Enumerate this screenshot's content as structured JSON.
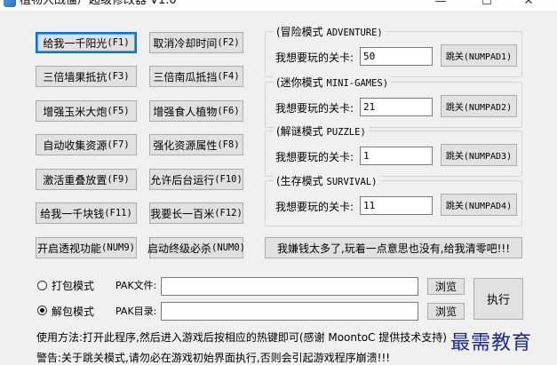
{
  "window": {
    "title": "植物大战僵尸超级修改器 V1.0",
    "minimize": "—",
    "maximize": "☐",
    "close": "✕"
  },
  "cheats": [
    {
      "label": "给我一千阳光",
      "key": "(F1)"
    },
    {
      "label": "取消冷却时间",
      "key": "(F2)"
    },
    {
      "label": "三倍墙果抵抗",
      "key": "(F3)"
    },
    {
      "label": "三倍南瓜抵挡",
      "key": "(F4)"
    },
    {
      "label": "增强玉米大炮",
      "key": "(F5)"
    },
    {
      "label": "增强食人植物",
      "key": "(F6)"
    },
    {
      "label": "自动收集资源",
      "key": "(F7)"
    },
    {
      "label": "强化资源属性",
      "key": "(F8)"
    },
    {
      "label": "激活重叠放置",
      "key": "(F9)"
    },
    {
      "label": "允许后台运行",
      "key": "(F10)"
    },
    {
      "label": "给我一千块钱",
      "key": "(F11)"
    },
    {
      "label": "我要长一百米",
      "key": "(F12)"
    },
    {
      "label": "开启透视功能",
      "key": "(NUM9)"
    },
    {
      "label": "启动终级必杀",
      "key": "(NUM0)"
    }
  ],
  "modes": [
    {
      "legend": "(冒险模式",
      "legend_en": "ADVENTURE)",
      "field_label": "我想要玩的关卡:",
      "value": "50",
      "button": "跳关(NUMPAD1)"
    },
    {
      "legend": "(迷你模式",
      "legend_en": "MINI-GAMES)",
      "field_label": "我想要玩的关卡:",
      "value": "21",
      "button": "跳关(NUMPAD2)"
    },
    {
      "legend": "(解谜模式",
      "legend_en": "PUZZLE)",
      "field_label": "我想要玩的关卡:",
      "value": "1",
      "button": "跳关(NUMPAD3)"
    },
    {
      "legend": "(生存模式",
      "legend_en": "SURVIVAL)",
      "field_label": "我想要玩的关卡:",
      "value": "11",
      "button": "跳关(NUMPAD4)"
    }
  ],
  "money_button": "我嫌钱太多了,玩着一点意思也没有,给我清零吧!!!",
  "pak": {
    "pack_mode": "打包模式",
    "unpack_mode": "解包模式",
    "pak_file_label": "PAK文件:",
    "pak_dir_label": "PAK目录:",
    "pak_file_value": "",
    "pak_dir_value": "",
    "browse": "浏览",
    "execute": "执行"
  },
  "footer": {
    "usage": "使用方法:打开此程序,然后进入游戏后按相应的热键即可(感谢 MoontoC 提供技术支持)",
    "warning": "警告:关于跳关模式,请勿必在游戏初始界面执行,否则会引起游戏程序崩溃!!!"
  },
  "watermark": "最需教育"
}
